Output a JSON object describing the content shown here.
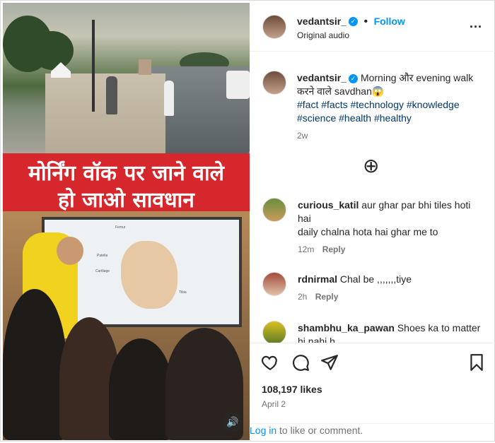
{
  "post": {
    "username": "vedantsir_",
    "follow_label": "Follow",
    "audio": "Original audio",
    "more_label": "...",
    "caption_text": "Morning और evening walk करने वाले savdhan😱",
    "hashtags": "#fact #facts #technology #knowledge #science #health #healthy",
    "caption_time": "2w",
    "load_more_label": "⊕"
  },
  "media": {
    "banner_line1": "मोर्निंग वॉक पर जाने वाले",
    "banner_line2": "हो जाओ सावधान",
    "screen_labels": [
      "Femur",
      "Patella",
      "Cartilage",
      "Tibia"
    ]
  },
  "comments": [
    {
      "user": "curious_katil",
      "text": "aur ghar par bhi tiles hoti hai",
      "text2": "daily chalna hota hai ghar me to",
      "time": "12m",
      "reply": "Reply"
    },
    {
      "user": "rdnirmal",
      "text": "Chal be ,,,,,,,tiye",
      "time": "2h",
      "reply": "Reply"
    },
    {
      "user": "shambhu_ka_pawan",
      "text": "Shoes ka to matter hi nahi h"
    }
  ],
  "footer": {
    "likes": "108,197 likes",
    "date": "April 2",
    "login_link": "Log in",
    "login_rest": "to like or comment."
  },
  "colors": {
    "accent": "#0095f6",
    "banner": "#d5272c"
  }
}
